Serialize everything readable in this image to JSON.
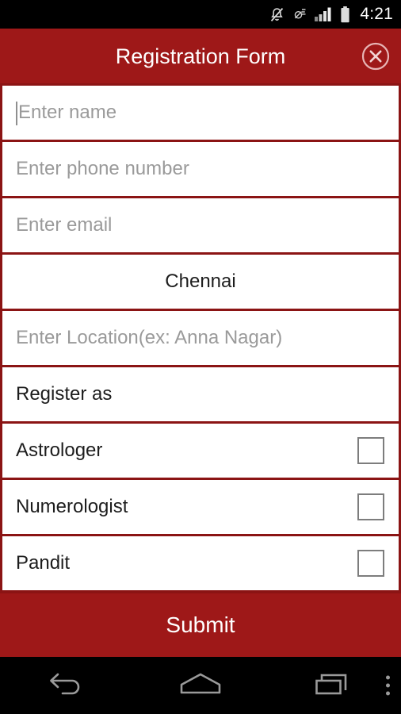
{
  "status_bar": {
    "time": "4:21",
    "icons": [
      "mute-bell-icon",
      "alarm-off-icon",
      "signal-bars-icon",
      "battery-icon"
    ]
  },
  "header": {
    "title": "Registration Form",
    "close_icon": "close-circle-icon",
    "background_color": "#9e1818",
    "title_color": "#ffffff"
  },
  "form": {
    "rows": [
      {
        "name": "name-field",
        "text": "Enter name",
        "kind": "placeholder",
        "caret": true
      },
      {
        "name": "phone-field",
        "text": "Enter phone number",
        "kind": "placeholder",
        "caret": false
      },
      {
        "name": "email-field",
        "text": "Enter email",
        "kind": "placeholder",
        "caret": false
      },
      {
        "name": "city-spinner",
        "text": "Chennai",
        "kind": "value-centered",
        "caret": false
      },
      {
        "name": "location-field",
        "text": "Enter Location(ex: Anna Nagar)",
        "kind": "placeholder",
        "caret": false
      },
      {
        "name": "register-as-label",
        "text": "Register as",
        "kind": "label",
        "caret": false
      },
      {
        "name": "checkbox-row-astrologer",
        "text": "Astrologer",
        "kind": "checkbox",
        "checked": false
      },
      {
        "name": "checkbox-row-numerologist",
        "text": "Numerologist",
        "kind": "checkbox",
        "checked": false
      },
      {
        "name": "checkbox-row-pandit",
        "text": "Pandit",
        "kind": "checkbox",
        "checked": false
      }
    ],
    "divider_color": "#8b1414",
    "placeholder_color": "#9a9a9a",
    "value_color": "#1d1d1d",
    "checkbox_border_color": "#7d7d7d"
  },
  "submit": {
    "label": "Submit",
    "background_color": "#9e1818",
    "label_color": "#ffffff"
  },
  "nav_bar": {
    "buttons": [
      "back-icon",
      "home-icon",
      "recents-icon"
    ],
    "overflow_icon": "overflow-menu-icon",
    "icon_color": "#9a9a9a"
  }
}
